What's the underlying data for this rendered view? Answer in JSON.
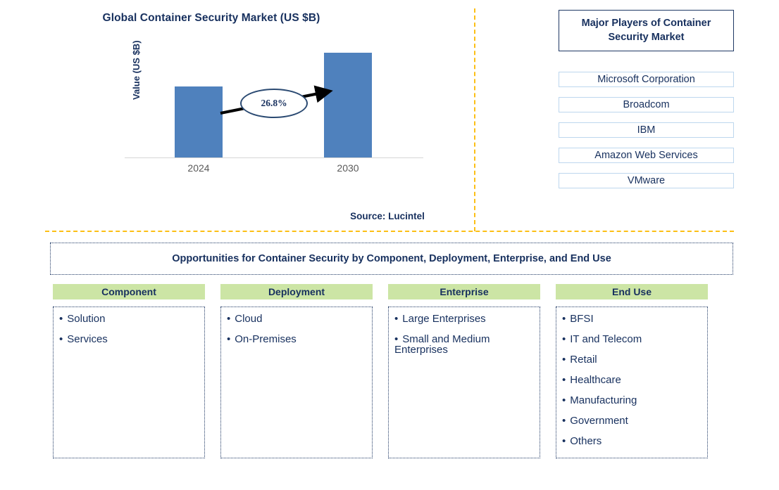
{
  "chart_panel": {
    "title": "Global Container Security Market (US $B)",
    "y_axis_label": "Value (US $B)",
    "cagr_label": "26.8%",
    "source": "Source: Lucintel"
  },
  "chart_data": {
    "type": "bar",
    "title": "Global Container Security Market (US $B)",
    "categories": [
      "2024",
      "2030"
    ],
    "values": [
      67,
      99
    ],
    "xlabel": "",
    "ylabel": "Value (US $B)",
    "ylim": [
      0,
      110
    ],
    "grid": false,
    "legend": "none",
    "bar_color": "#4F81BD",
    "annotations": [
      {
        "text": "26.8%",
        "type": "cagr-callout",
        "from": "2024",
        "to": "2030"
      }
    ]
  },
  "players": {
    "header": "Major Players of Container Security Market",
    "items": [
      "Microsoft Corporation",
      "Broadcom",
      "IBM",
      "Amazon Web Services",
      "VMware"
    ]
  },
  "opportunities": {
    "banner": "Opportunities for Container Security by Component, Deployment, Enterprise, and End Use",
    "columns": [
      {
        "header": "Component",
        "items": [
          "Solution",
          "Services"
        ]
      },
      {
        "header": "Deployment",
        "items": [
          "Cloud",
          "On-Premises"
        ]
      },
      {
        "header": "Enterprise",
        "items": [
          "Large Enterprises",
          "Small and Medium\nEnterprises"
        ]
      },
      {
        "header": "End Use",
        "items": [
          "BFSI",
          "IT and Telecom",
          "Retail",
          "Healthcare",
          "Manufacturing",
          "Government",
          "Others"
        ]
      }
    ]
  },
  "colors": {
    "navy": "#17305e",
    "bar_blue": "#4F81BD",
    "divider_amber": "#FCBF15",
    "segment_green": "#CCE5A5",
    "player_border": "#BDD7EE"
  }
}
